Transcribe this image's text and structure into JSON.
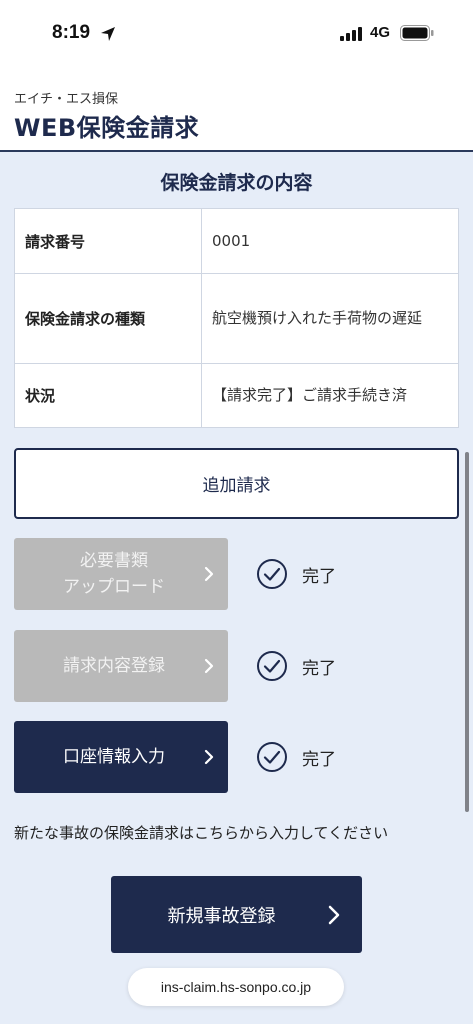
{
  "status_bar": {
    "time": "8:19",
    "network": "4G"
  },
  "header": {
    "company": "エイチ・エス損保",
    "title": "WEB保険金請求"
  },
  "section": {
    "title": "保険金請求の内容"
  },
  "claim_table": {
    "rows": [
      {
        "label": "請求番号",
        "value": "0001"
      },
      {
        "label": "保険金請求の種類",
        "value": "航空機預け入れた手荷物の遅延"
      },
      {
        "label": "状況",
        "value": "【請求完了】ご請求手続き済"
      }
    ]
  },
  "add_claim_button": "追加請求",
  "steps": [
    {
      "label": "必要書類\nアップロード",
      "status": "完了",
      "enabled": false
    },
    {
      "label": "請求内容登録",
      "status": "完了",
      "enabled": false
    },
    {
      "label": "口座情報入力",
      "status": "完了",
      "enabled": true
    }
  ],
  "note": "新たな事故の保険金請求はこちらから入力してください",
  "new_accident_button": "新規事故登録",
  "url": "ins-claim.hs-sonpo.co.jp",
  "colors": {
    "primary": "#1e2a4d",
    "background": "#e6edf8",
    "disabled": "#b9b9b9"
  }
}
